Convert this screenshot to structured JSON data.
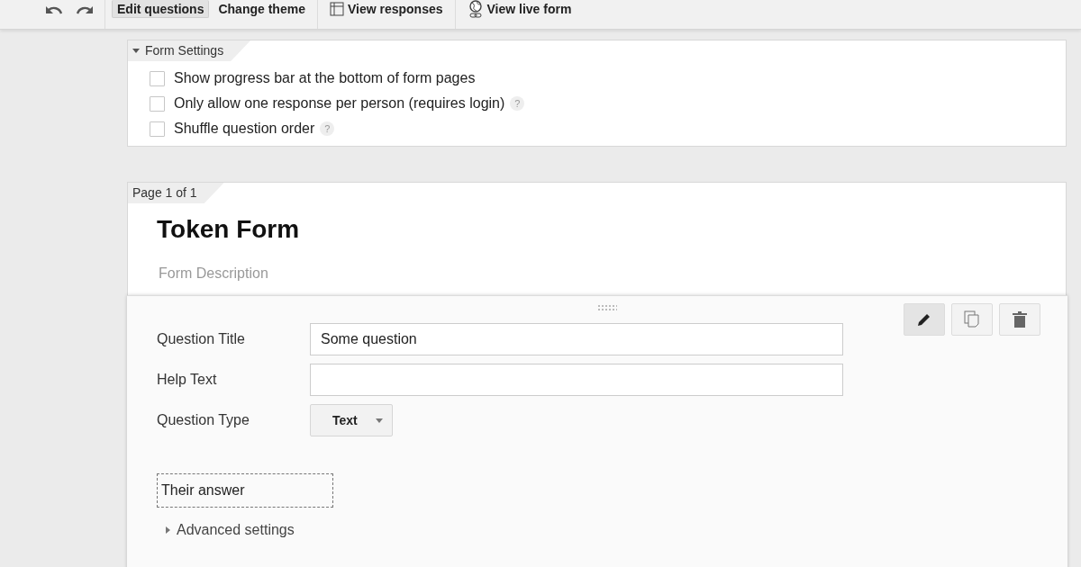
{
  "toolbar": {
    "history": [
      {
        "kind": "undo"
      },
      {
        "kind": "redo"
      }
    ],
    "groups": [
      [
        {
          "label": "Edit questions",
          "kind": "plain",
          "selected": true
        },
        {
          "label": "Change theme",
          "kind": "plain",
          "selected": false
        }
      ],
      [
        {
          "label": "View responses",
          "kind": "responses",
          "selected": false
        }
      ],
      [
        {
          "label": "View live form",
          "kind": "live",
          "selected": false
        }
      ]
    ]
  },
  "form_settings": {
    "title": "Form Settings",
    "expanded": true,
    "options": [
      {
        "label": "Show progress bar at the bottom of form pages",
        "checked": false
      },
      {
        "label": "Only allow one response per person (requires login)",
        "checked": false,
        "help": "?"
      },
      {
        "label": "Shuffle question order",
        "checked": false,
        "help": "?"
      }
    ]
  },
  "page": {
    "tab": "Page 1 of 1",
    "title": "Token Form",
    "description_placeholder": "Form Description"
  },
  "question": {
    "actions": [
      {
        "kind": "edit",
        "selected": true
      },
      {
        "kind": "duplicate",
        "selected": false
      },
      {
        "kind": "delete",
        "selected": false
      }
    ],
    "fields": [
      {
        "label": "Question Title",
        "value": "Some question"
      },
      {
        "label": "Help Text"
      }
    ],
    "type": {
      "label": "Question Type",
      "value": "Text"
    },
    "answer_preview": "Their answer",
    "advanced": {
      "label": "Advanced settings",
      "expanded": false
    }
  }
}
